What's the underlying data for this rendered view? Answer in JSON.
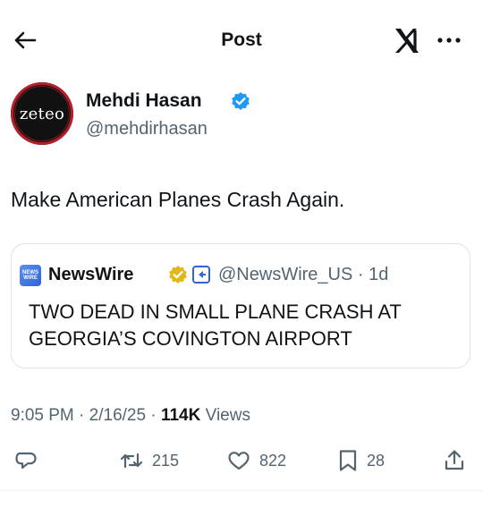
{
  "header": {
    "title": "Post",
    "back_icon": "arrow-left-icon",
    "logo_icon": "x-logo-icon",
    "more_icon": "more-dots-icon"
  },
  "author": {
    "name": "Mehdi Hasan",
    "handle": "@mehdirhasan",
    "avatar_text": "zeteo",
    "verified": true,
    "verified_color": "#1d9bf0"
  },
  "post": {
    "text": "Make American Planes Crash Again."
  },
  "quote": {
    "logo_lines": [
      "NEWS",
      "WIRE"
    ],
    "name": "NewsWire",
    "verified_color": "#e2b719",
    "handle_time": "@NewsWire_US · 1d",
    "text": "TWO DEAD IN SMALL PLANE CRASH AT GEORGIA’S COVINGTON AIRPORT"
  },
  "meta": {
    "time": "9:05 PM",
    "date": "2/16/25",
    "views_count": "114K",
    "views_label": "Views"
  },
  "actions": {
    "reply_count": "",
    "repost_count": "215",
    "like_count": "822",
    "bookmark_count": "28"
  },
  "colors": {
    "text": "#0f1419",
    "secondary": "#536471",
    "border": "#dfe3e7",
    "accent": "#1d9bf0",
    "avatar_ring": "#b81e2a"
  }
}
